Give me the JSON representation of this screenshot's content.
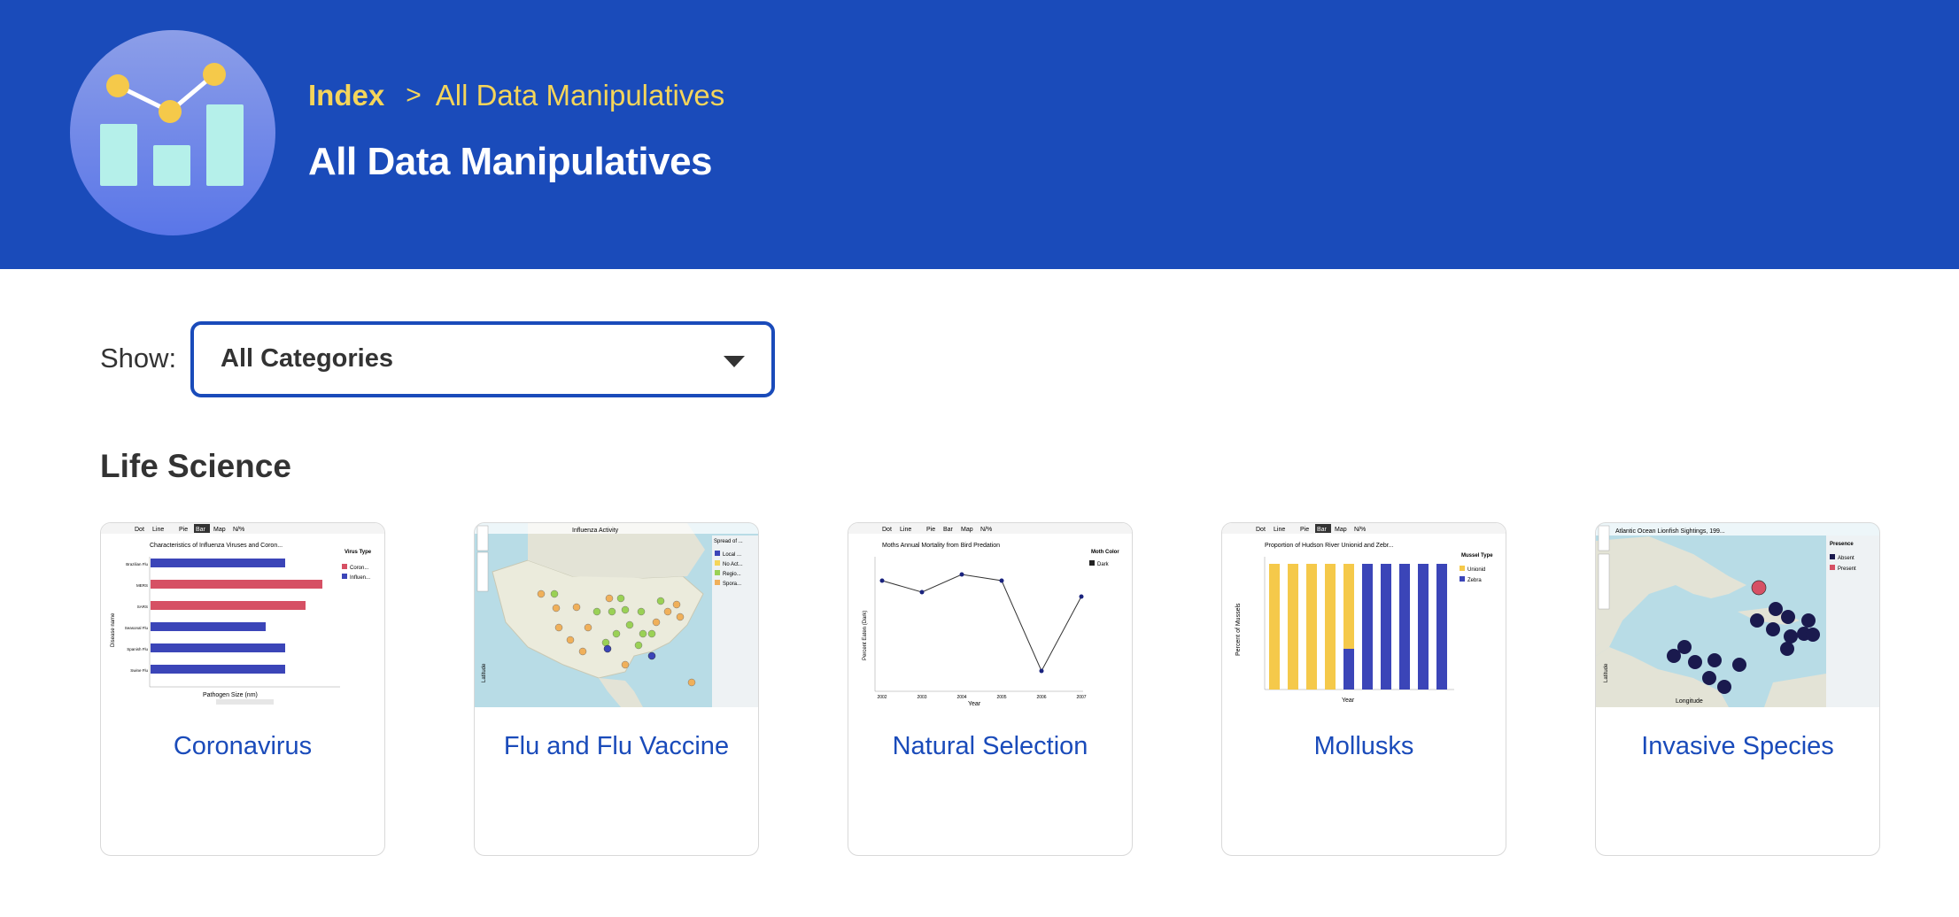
{
  "header": {
    "breadcrumb": {
      "index_label": "Index",
      "separator": ">",
      "current_label": "All Data Manipulatives"
    },
    "title": "All Data Manipulatives",
    "logo_icon": "chart-logo-icon",
    "colors": {
      "background": "#1a4bba",
      "breadcrumb": "#f5d55a",
      "title": "#ffffff"
    }
  },
  "filter": {
    "label": "Show:",
    "selected": "All Categories",
    "caret_icon": "caret-down-icon"
  },
  "section": {
    "title": "Life Science",
    "cards": [
      {
        "title": "Coronavirus",
        "thumb": {
          "toolbar": [
            "Dot",
            "Line",
            "Pie",
            "Bar",
            "Map",
            "N/%"
          ],
          "chart_title": "Characteristics of Influenza Viruses and Coron...",
          "legend_title": "Virus Type",
          "legend_items": [
            "Coron...",
            "Influen..."
          ],
          "y_label": "Disease name",
          "x_label": "Pathogen Size (nm)",
          "bar_labels": [
            "Brazilian Flu",
            "MERS",
            "SARS",
            "Seasonal Flu",
            "Spanish Flu",
            "Swine Flu"
          ]
        }
      },
      {
        "title": "Flu and Flu Vaccine",
        "thumb": {
          "chart_title": "Influenza Activity",
          "legend_title": "Spread of ...",
          "legend_items": [
            "Local ...",
            "No Act...",
            "Regio...",
            "Spora..."
          ],
          "y_label": "Latitude"
        }
      },
      {
        "title": "Natural Selection",
        "thumb": {
          "toolbar": [
            "Dot",
            "Line",
            "Pie",
            "Bar",
            "Map",
            "N/%"
          ],
          "chart_title": "Moths Annual Mortality from Bird Predation",
          "legend_title": "Moth Color",
          "legend_items": [
            "Dark"
          ],
          "y_label": "Percent Eaten (Dark)",
          "x_label": "Year",
          "x_ticks": [
            "2002",
            "2003",
            "2004",
            "2005",
            "2006",
            "2007"
          ]
        }
      },
      {
        "title": "Mollusks",
        "thumb": {
          "toolbar": [
            "Dot",
            "Line",
            "Pie",
            "Bar",
            "Map",
            "N/%"
          ],
          "chart_title": "Proportion of Hudson River Unionid and Zebr...",
          "legend_title": "Mussel Type",
          "legend_items": [
            "Unionid",
            "Zebra"
          ],
          "y_label": "Percent of Mussels",
          "x_label": "Year"
        }
      },
      {
        "title": "Invasive Species",
        "thumb": {
          "chart_title": "Atlantic Ocean Lionfish Sightings, 199...",
          "legend_title": "Presence",
          "legend_items": [
            "Absent",
            "Present"
          ],
          "y_label": "Latitude",
          "x_label": "Longitude"
        }
      }
    ]
  }
}
